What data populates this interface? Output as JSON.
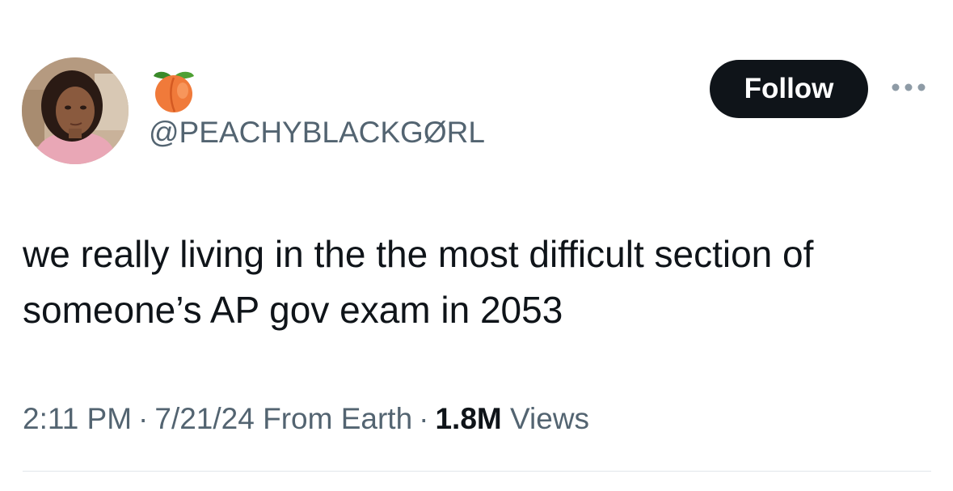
{
  "user": {
    "display_name_emoji": "peach-emoji",
    "handle": "@PEACHYBLACKGØRL"
  },
  "actions": {
    "follow_label": "Follow",
    "more_icon": "more-horizontal-icon"
  },
  "tweet": {
    "text": "we really living in the the most difficult section of someone’s AP gov exam in 2053",
    "time": "2:11 PM",
    "date": "7/21/24",
    "source": "From Earth",
    "separator": "·",
    "views_count": "1.8M",
    "views_label": "Views"
  },
  "colors": {
    "text_primary": "#0f1419",
    "text_secondary": "#536471",
    "button_bg": "#0f1419",
    "divider": "#e1e6ea"
  }
}
